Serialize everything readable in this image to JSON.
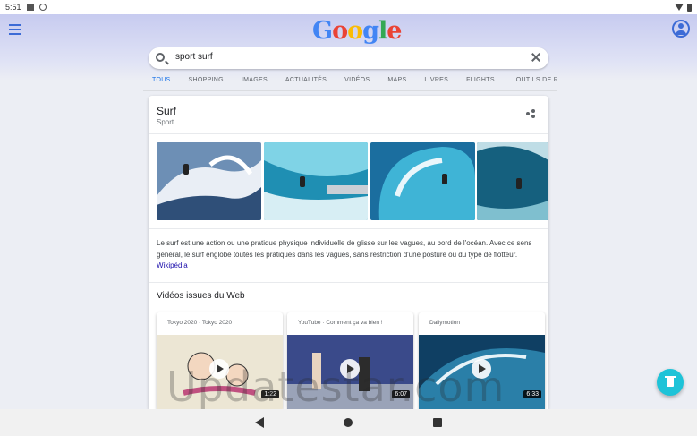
{
  "status_bar": {
    "time": "5:51"
  },
  "logo": {
    "letters": [
      "G",
      "o",
      "o",
      "g",
      "l",
      "e"
    ]
  },
  "search": {
    "query": "sport surf"
  },
  "tabs": [
    {
      "label": "TOUS",
      "active": true
    },
    {
      "label": "SHOPPING"
    },
    {
      "label": "IMAGES"
    },
    {
      "label": "ACTUALITÉS"
    },
    {
      "label": "VIDÉOS"
    },
    {
      "label": "MAPS"
    },
    {
      "label": "LIVRES"
    },
    {
      "label": "FLIGHTS"
    },
    {
      "label": "OUTILS DE RECHERCHE"
    }
  ],
  "knowledge_panel": {
    "title": "Surf",
    "subtitle": "Sport",
    "description": "Le surf est une action ou une pratique physique individuelle de glisse sur les vagues, au bord de l'océan. Avec ce sens général, le surf englobe toutes les pratiques dans les vagues, sans restriction d'une posture ou du type de flotteur.",
    "wiki_label": "Wikipédia",
    "images_count": 4
  },
  "videos": {
    "heading": "Vidéos issues du Web",
    "items": [
      {
        "source": "Tokyo 2020 · Tokyo 2020",
        "duration": "1:22"
      },
      {
        "source": "YouTube · Comment ça va bien !",
        "duration": "6:07"
      },
      {
        "source": "Dailymotion",
        "duration": "6:33"
      }
    ]
  },
  "watermark": "Updatestar.com",
  "colors": {
    "accent": "#1a73e8",
    "fab": "#1ec3d8",
    "link": "#1a0dab",
    "header": "#c7cbf0"
  },
  "icons": [
    "menu-icon",
    "account-icon",
    "search-icon",
    "clear-icon",
    "share-icon",
    "play-icon",
    "delete-icon",
    "back-icon",
    "home-icon",
    "recents-icon"
  ]
}
